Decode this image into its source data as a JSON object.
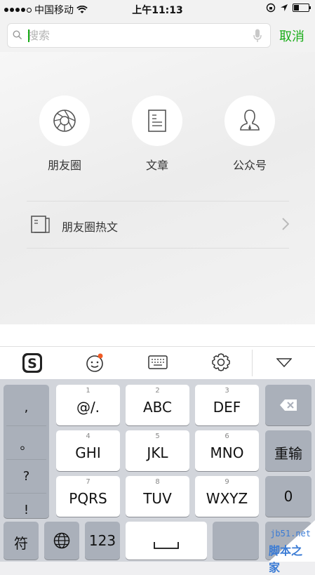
{
  "status": {
    "carrier": "中国移动",
    "time": "上午11:13"
  },
  "search": {
    "placeholder": "搜索",
    "cancel": "取消"
  },
  "categories": [
    {
      "label": "朋友圈",
      "icon": "shutter-icon"
    },
    {
      "label": "文章",
      "icon": "document-icon"
    },
    {
      "label": "公众号",
      "icon": "person-icon"
    }
  ],
  "hot": {
    "label": "朋友圈热文"
  },
  "toolbar": {
    "items": [
      "sogou-logo-icon",
      "emoji-icon",
      "keyboard-icon",
      "settings-icon",
      "collapse-icon"
    ]
  },
  "keyboard": {
    "punct": [
      ",",
      "。",
      "?",
      "!"
    ],
    "row1": [
      {
        "num": "1",
        "label": "@/."
      },
      {
        "num": "2",
        "label": "ABC"
      },
      {
        "num": "3",
        "label": "DEF"
      }
    ],
    "row2": [
      {
        "num": "4",
        "label": "GHI"
      },
      {
        "num": "5",
        "label": "JKL"
      },
      {
        "num": "6",
        "label": "MNO"
      }
    ],
    "row3": [
      {
        "num": "7",
        "label": "PQRS"
      },
      {
        "num": "8",
        "label": "TUV"
      },
      {
        "num": "9",
        "label": "WXYZ"
      }
    ],
    "retype": "重输",
    "zero": "0",
    "symbol": "符",
    "num_switch": "123"
  },
  "watermark": {
    "site": "jb51.net",
    "name": "脚本之家"
  },
  "colors": {
    "accent": "#1aad19",
    "notify_dot": "#f05a24"
  }
}
